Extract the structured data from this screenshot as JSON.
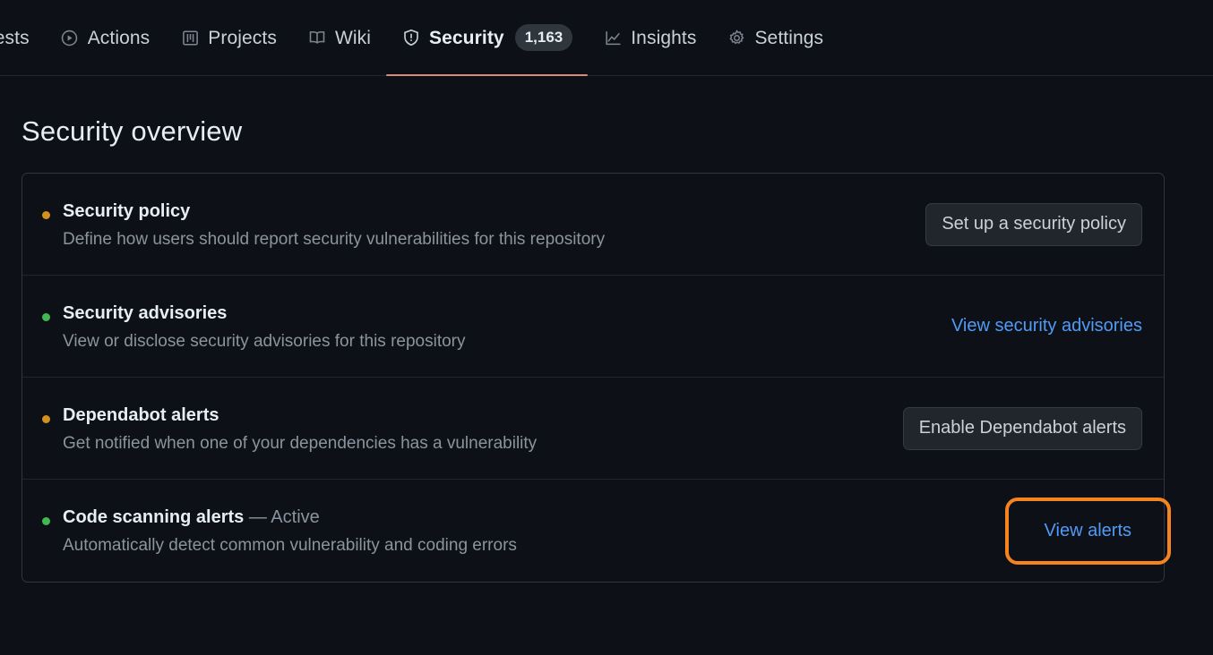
{
  "nav": {
    "items": [
      {
        "label": "uests",
        "icon": "none",
        "truncated": true,
        "active": false
      },
      {
        "label": "Actions",
        "icon": "play-circle-icon",
        "active": false
      },
      {
        "label": "Projects",
        "icon": "table-icon",
        "active": false
      },
      {
        "label": "Wiki",
        "icon": "book-icon",
        "active": false
      },
      {
        "label": "Security",
        "icon": "shield-alert-icon",
        "active": true,
        "counter": "1,163"
      },
      {
        "label": "Insights",
        "icon": "graph-icon",
        "active": false
      },
      {
        "label": "Settings",
        "icon": "gear-icon",
        "active": false
      }
    ],
    "active_underline_color": "#d98a7a"
  },
  "page": {
    "title": "Security overview"
  },
  "overview": {
    "rows": [
      {
        "dot": "orange",
        "title": "Security policy",
        "status": "",
        "description": "Define how users should report security vulnerabilities for this repository",
        "action": {
          "type": "button",
          "label": "Set up a security policy"
        }
      },
      {
        "dot": "green",
        "title": "Security advisories",
        "status": "",
        "description": "View or disclose security advisories for this repository",
        "action": {
          "type": "link",
          "label": "View security advisories"
        }
      },
      {
        "dot": "orange",
        "title": "Dependabot alerts",
        "status": "",
        "description": "Get notified when one of your dependencies has a vulnerability",
        "action": {
          "type": "button",
          "label": "Enable Dependabot alerts"
        }
      },
      {
        "dot": "green",
        "title": "Code scanning alerts",
        "status": "— Active",
        "description": "Automatically detect common vulnerability and coding errors",
        "action": {
          "type": "link",
          "label": "View alerts",
          "highlighted": true
        }
      }
    ]
  },
  "colors": {
    "background": "#0d1117",
    "border": "#30363d",
    "link": "#4f9bf5",
    "dot_orange": "#d2901c",
    "dot_green": "#3fb950",
    "highlight_ring": "#f5841f",
    "button_bg": "#21262d"
  }
}
